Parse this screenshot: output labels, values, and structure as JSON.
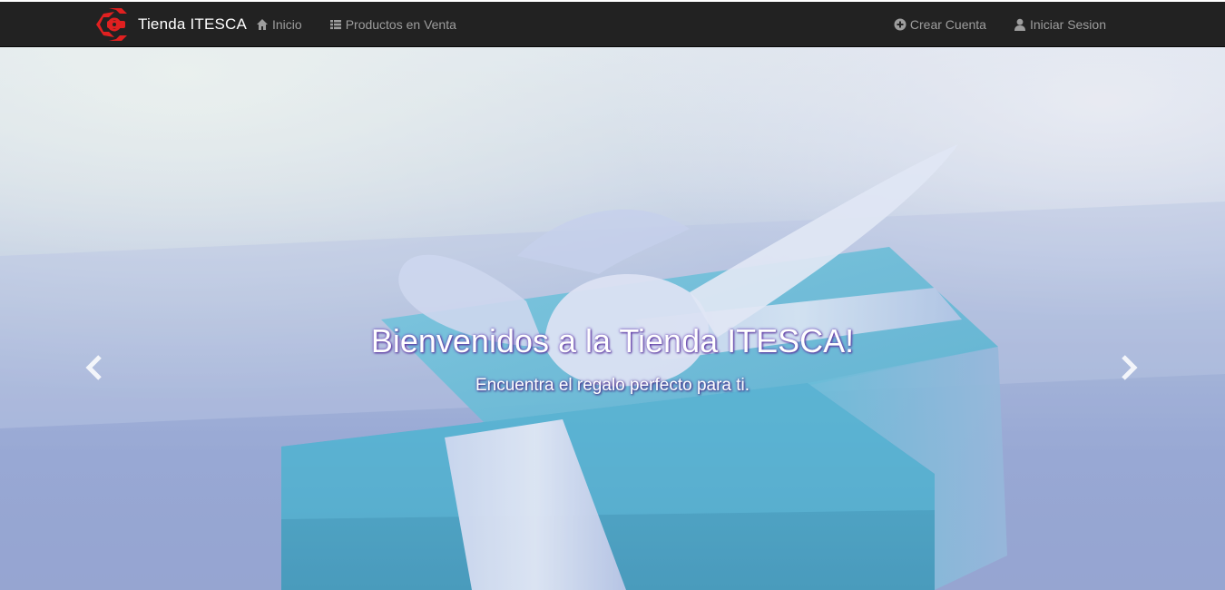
{
  "navbar": {
    "brand": "Tienda ITESCA",
    "left_links": [
      {
        "label": "Inicio",
        "icon": "home-icon"
      },
      {
        "label": "Productos en Venta",
        "icon": "list-icon"
      }
    ],
    "right_links": [
      {
        "label": "Crear Cuenta",
        "icon": "plus-circle-icon"
      },
      {
        "label": "Iniciar Sesion",
        "icon": "user-icon"
      }
    ]
  },
  "hero": {
    "title": "Bienvenidos a la Tienda ITESCA!",
    "subtitle": "Encuentra el regalo perfecto para ti.",
    "prev_icon": "chevron-left-icon",
    "next_icon": "chevron-right-icon"
  },
  "colors": {
    "navbar_bg": "#222222",
    "nav_link": "#9d9d9d",
    "brand_logo": "#e02020",
    "gift_box": "#3fa9c9"
  }
}
